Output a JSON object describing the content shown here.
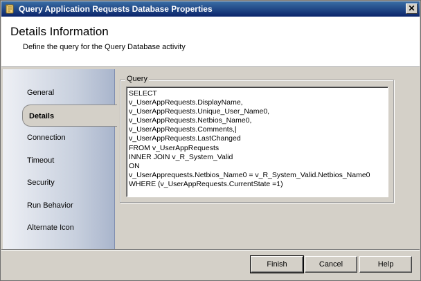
{
  "window": {
    "title": "Query Application Requests Database Properties",
    "close_label": "✕"
  },
  "header": {
    "title": "Details Information",
    "subtitle": "Define the query for the Query Database activity"
  },
  "sidebar": {
    "items": [
      {
        "label": "General",
        "selected": false
      },
      {
        "label": "Details",
        "selected": true
      },
      {
        "label": "Connection",
        "selected": false
      },
      {
        "label": "Timeout",
        "selected": false
      },
      {
        "label": "Security",
        "selected": false
      },
      {
        "label": "Run Behavior",
        "selected": false
      },
      {
        "label": "Alternate Icon",
        "selected": false
      }
    ]
  },
  "query": {
    "group_label": "Query",
    "text": "SELECT\nv_UserAppRequests.DisplayName,\nv_UserAppRequests.Unique_User_Name0,\nv_UserAppRequests.Netbios_Name0,\nv_UserAppRequests.Comments,|\nv_UserAppRequests.LastChanged\nFROM v_UserAppRequests\nINNER JOIN v_R_System_Valid\nON\nv_UserApprequests.Netbios_Name0 = v_R_System_Valid.Netbios_Name0\nWHERE (v_UserAppRequests.CurrentState =1)"
  },
  "buttons": {
    "finish": "Finish",
    "cancel": "Cancel",
    "help": "Help"
  }
}
